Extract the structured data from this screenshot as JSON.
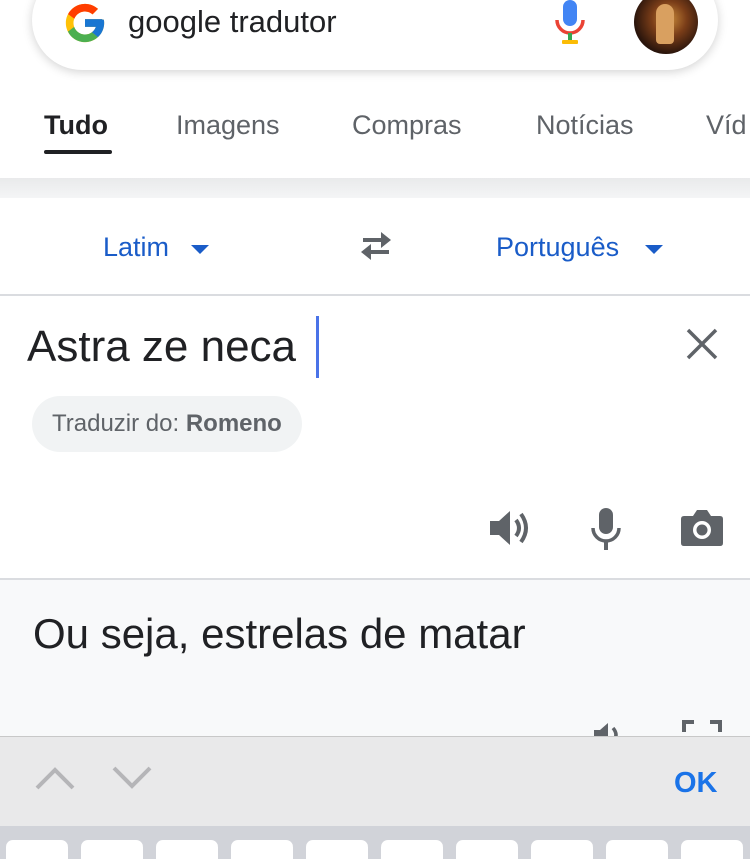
{
  "search": {
    "query": "google tradutor"
  },
  "tabs": [
    {
      "label": "Tudo",
      "active": true
    },
    {
      "label": "Imagens",
      "active": false
    },
    {
      "label": "Compras",
      "active": false
    },
    {
      "label": "Notícias",
      "active": false
    },
    {
      "label": "Víd",
      "active": false
    }
  ],
  "translator": {
    "source_language": "Latim",
    "target_language": "Português",
    "source_text": "Astra ze neca",
    "detect_prefix": "Traduzir do:",
    "detect_language": "Romeno",
    "translation": "Ou seja, estrelas de matar"
  },
  "keyboard": {
    "ok_label": "OK"
  },
  "icons": {
    "google_logo": "google-g-icon",
    "voice_search": "microphone-icon",
    "avatar": "profile-avatar",
    "swap": "swap-languages-icon",
    "clear": "close-icon",
    "listen": "speaker-icon",
    "voice_input": "microphone-icon",
    "camera": "camera-icon",
    "previous": "chevron-up-icon",
    "next": "chevron-down-icon"
  },
  "colors": {
    "accent": "#1a5cc8",
    "ok": "#1a73e8",
    "cursor": "#4a73e8"
  }
}
